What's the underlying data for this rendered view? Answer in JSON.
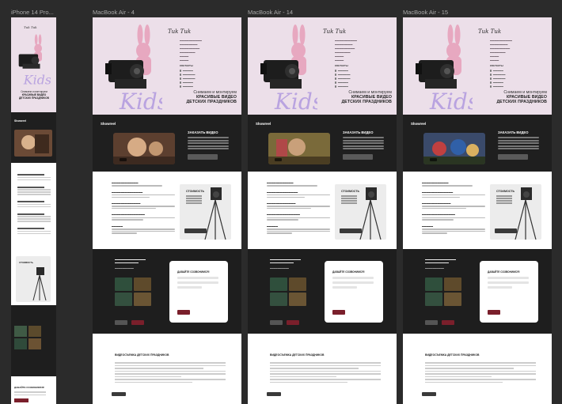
{
  "frames": [
    {
      "label": "iPhone 14 Pro..."
    },
    {
      "label": "MacBook Air - 4"
    },
    {
      "label": "MacBook Air - 14"
    },
    {
      "label": "MacBook Air - 15"
    }
  ],
  "site": {
    "logo": "Tuk Tuk",
    "tagline_1": "Снимаем и монтируем",
    "tagline_2": "КРАСИВЫЕ ВИДЕО",
    "tagline_3": "ДЕТСКИХ ПРАЗДНИКОВ",
    "contacts_title": "КОНТАКТЫ",
    "showreel_title": "Showreel",
    "order_title": "ЗАКАЗАТЬ ВИДЕО",
    "price_title": "СТОИМОСТЬ",
    "form_title": "ДАВАЙТЕ СОЗВОНИМСЯ!",
    "article_title": "ВИДЕОСЪЕМКА ДЕТСКИХ ПРАЗДНИКОВ",
    "phone_article_title": "ДАВАЙТЕ СОЗВОНИМСЯ!"
  },
  "colors": {
    "canvas": "#2b2b2b",
    "hero_bg": "#ecdfe9",
    "dark_bg": "#1f1f1f",
    "accent": "#7a1f2b",
    "bunny": "#e7a8c0",
    "lilac_text": "#b9a3e0"
  }
}
